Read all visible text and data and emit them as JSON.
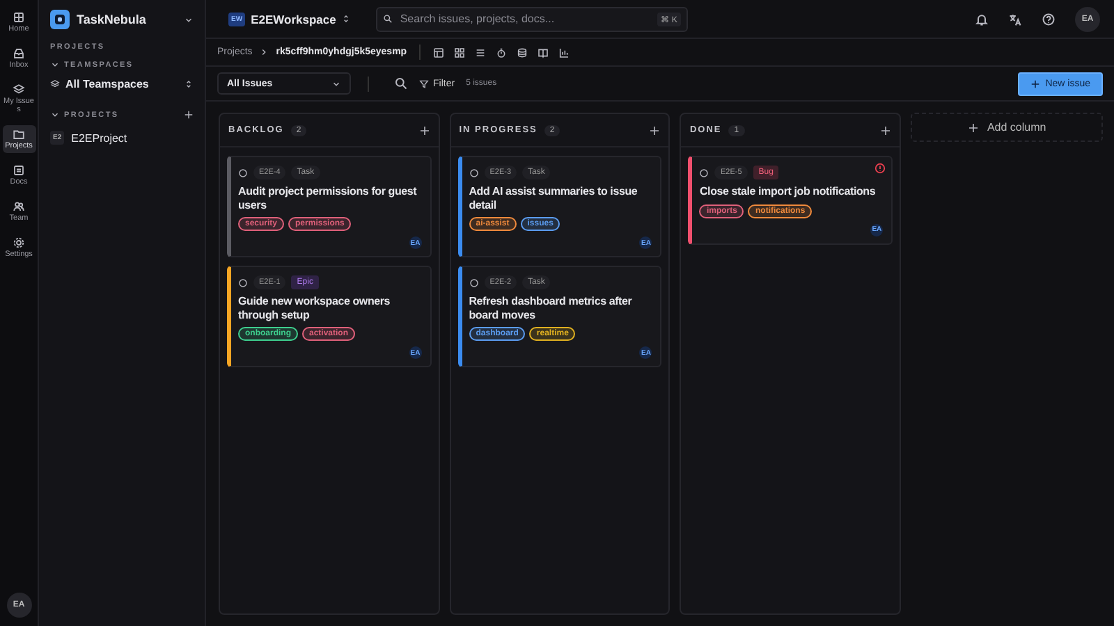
{
  "rail": [
    {
      "label": "Home",
      "selected": false
    },
    {
      "label": "Inbox",
      "selected": false
    },
    {
      "label": "My Issues",
      "selected": false
    },
    {
      "label": "Projects",
      "selected": true
    },
    {
      "label": "Docs",
      "selected": false
    },
    {
      "label": "Team",
      "selected": false
    },
    {
      "label": "Settings",
      "selected": false
    }
  ],
  "rail_avatar": "EA",
  "sidebar": {
    "brand": "TaskNebula",
    "section": "PROJECTS",
    "teamspaces_heading": "TEAMSPACES",
    "teamspace": "All Teamspaces",
    "projects_heading": "PROJECTS",
    "projects": [
      {
        "badge": "E2",
        "name": "E2EProject"
      }
    ]
  },
  "topbar": {
    "workspace_badge": "EW",
    "workspace": "E2EWorkspace",
    "search": {
      "placeholder": "Search issues, projects, docs..."
    },
    "shortcut": "⌘ K",
    "avatar": "EA"
  },
  "breadcrumb": {
    "parent": "Projects",
    "current": "rk5cff9hm0yhdgj5k5eyesmp"
  },
  "toolbar": {
    "view": "All Issues",
    "filter": "Filter",
    "count": "5 issues",
    "new_button": "New issue"
  },
  "columns": [
    {
      "title": "BACKLOG",
      "count": "2",
      "cards": [
        {
          "id": "E2E-4",
          "type": "Task",
          "kind": "task",
          "title": "Audit project permissions for guest users",
          "color": "#5c5c63",
          "urgent": false,
          "tags": [
            {
              "label": "security",
              "color": "#e0607a"
            },
            {
              "label": "permissions",
              "color": "#e0607a"
            }
          ],
          "assignee": "EA"
        },
        {
          "id": "E2E-1",
          "type": "Epic",
          "kind": "epic",
          "title": "Guide new workspace owners through setup",
          "color": "#f5a524",
          "urgent": false,
          "tags": [
            {
              "label": "onboarding",
              "color": "#3ecf8e"
            },
            {
              "label": "activation",
              "color": "#e0607a"
            }
          ],
          "assignee": "EA"
        }
      ]
    },
    {
      "title": "IN PROGRESS",
      "count": "2",
      "cards": [
        {
          "id": "E2E-3",
          "type": "Task",
          "kind": "task",
          "title": "Add AI assist summaries to issue detail",
          "color": "#3b8cf0",
          "urgent": false,
          "tags": [
            {
              "label": "ai-assist",
              "color": "#f08a3c"
            },
            {
              "label": "issues",
              "color": "#5b9cf0"
            }
          ],
          "assignee": "EA"
        },
        {
          "id": "E2E-2",
          "type": "Task",
          "kind": "task",
          "title": "Refresh dashboard metrics after board moves",
          "color": "#3b8cf0",
          "urgent": false,
          "tags": [
            {
              "label": "dashboard",
              "color": "#5b9cf0"
            },
            {
              "label": "realtime",
              "color": "#e0b020"
            }
          ],
          "assignee": "EA"
        }
      ]
    },
    {
      "title": "DONE",
      "count": "1",
      "cards": [
        {
          "id": "E2E-5",
          "type": "Bug",
          "kind": "bug",
          "title": "Close stale import job notifications",
          "color": "#f0506e",
          "urgent": true,
          "tags": [
            {
              "label": "imports",
              "color": "#e0607a"
            },
            {
              "label": "notifications",
              "color": "#f08a3c"
            }
          ],
          "assignee": "EA"
        }
      ]
    }
  ],
  "add_column": "Add column"
}
